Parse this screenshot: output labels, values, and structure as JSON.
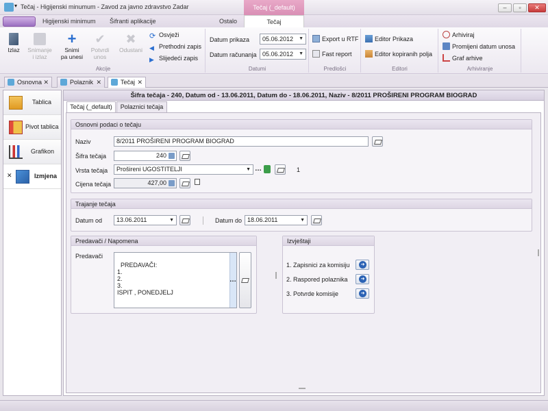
{
  "window": {
    "title": "Tečaj - Higijenski minumum - Zavod za javno zdravstvo Zadar",
    "context_tab": "Tečaj (_default)"
  },
  "ribbon_tabs": [
    "Higijenski minimum",
    "Šifranti aplikacije",
    "Ostalo",
    "Tečaj"
  ],
  "ribbon": {
    "akcije": {
      "label": "Akcije",
      "izlaz": "Izlaz",
      "snimanje_izlaz": "Snimanje\ni izlaz",
      "snimi": "Snimi\npa unesi",
      "potvrdi": "Potvrdi\nunos",
      "odustani": "Odustani",
      "osvjezi": "Osvježi",
      "prethodni": "Prethodni zapis",
      "sljedeci": "Slijedeći zapis"
    },
    "datumi": {
      "label": "Datumi",
      "prikaza_label": "Datum prikaza",
      "prikaza_value": "05.06.2012",
      "racunanja_label": "Datum računanja",
      "racunanja_value": "05.06.2012"
    },
    "predlosci": {
      "label": "Predlošci",
      "export": "Export u RTF",
      "fast": "Fast report"
    },
    "editori": {
      "label": "Editori",
      "prikaza": "Editor Prikaza",
      "kopiranih": "Editor kopiranih polja"
    },
    "arhiviranje": {
      "label": "Arhiviranje",
      "arhiviraj": "Arhiviraj",
      "promijeni": "Promijeni datum unosa",
      "graf": "Graf arhive"
    }
  },
  "doc_tabs": [
    "Osnovna",
    "Polaznik",
    "Tečaj"
  ],
  "left_nav": [
    "Tablica",
    "Pivot tablica",
    "Grafikon",
    "Izmjena"
  ],
  "header": "Šifra tečaja - 240, Datum od - 13.06.2011, Datum do - 18.06.2011, Naziv - 8/2011 PROŠIRENI PROGRAM BIOGRAD",
  "inner_tabs": [
    "Tečaj (_default)",
    "Polaznici tečaja"
  ],
  "osnovni": {
    "title": "Osnovni podaci o tečaju",
    "naziv_label": "Naziv",
    "naziv_value": "8/2011 PROŠIRENI PROGRAM BIOGRAD",
    "sifra_label": "Šifra tečaja",
    "sifra_value": "240",
    "vrsta_label": "Vrsta tečaja",
    "vrsta_value": "Prošireni UGOSTITELJI",
    "vrsta_id": "1",
    "cijena_label": "Cijena tečaja",
    "cijena_value": "427,00"
  },
  "trajanje": {
    "title": "Trajanje tečaja",
    "od_label": "Datum od",
    "od_value": "13.06.2011",
    "do_label": "Datum do",
    "do_value": "18.06.2011"
  },
  "predavaci": {
    "title": "Predavači / Napomena",
    "label": "Predavači",
    "memo": "PREDAVAČI:\n1.\n2.\n3.\nISPIT , PONEDJELJ"
  },
  "izvjestaji": {
    "title": "Izvještaji",
    "items": [
      "1. Zapisnici za komisiju",
      "2. Raspored polaznika",
      "3. Potvrde komisije"
    ]
  }
}
